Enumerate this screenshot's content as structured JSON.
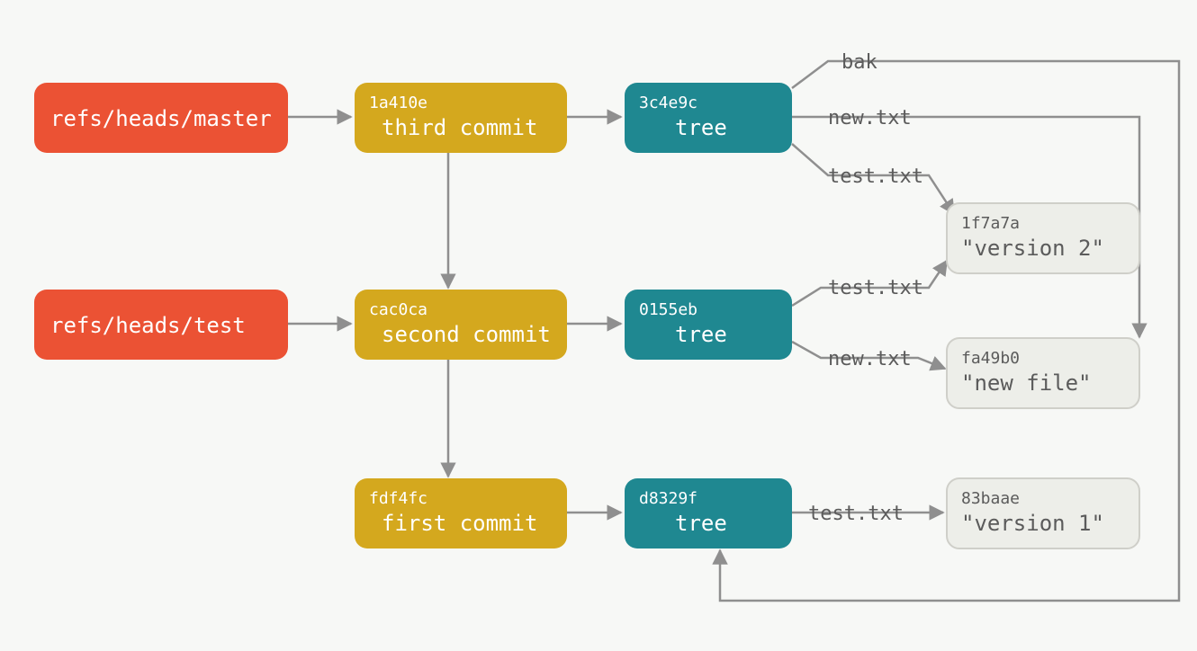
{
  "colors": {
    "ref": "#eb5234",
    "commit": "#d4a81e",
    "tree": "#1f8891",
    "blob_fill": "#edeee9",
    "blob_stroke": "#cfcfc9",
    "arrow": "#8f8f8f",
    "bg": "#f7f8f6"
  },
  "refs": {
    "master": {
      "label": "refs/heads/master"
    },
    "test": {
      "label": "refs/heads/test"
    }
  },
  "commits": {
    "third": {
      "sha": "1a410e",
      "label": "third commit"
    },
    "second": {
      "sha": "cac0ca",
      "label": "second commit"
    },
    "first": {
      "sha": "fdf4fc",
      "label": "first commit"
    }
  },
  "trees": {
    "t3": {
      "sha": "3c4e9c",
      "label": "tree"
    },
    "t2": {
      "sha": "0155eb",
      "label": "tree"
    },
    "t1": {
      "sha": "d8329f",
      "label": "tree"
    }
  },
  "blobs": {
    "v2": {
      "sha": "1f7a7a",
      "label": "\"version 2\""
    },
    "nf": {
      "sha": "fa49b0",
      "label": "\"new file\""
    },
    "v1": {
      "sha": "83baae",
      "label": "\"version 1\""
    }
  },
  "edges": {
    "bak": "bak",
    "newtxt": "new.txt",
    "testtxt": "test.txt"
  }
}
